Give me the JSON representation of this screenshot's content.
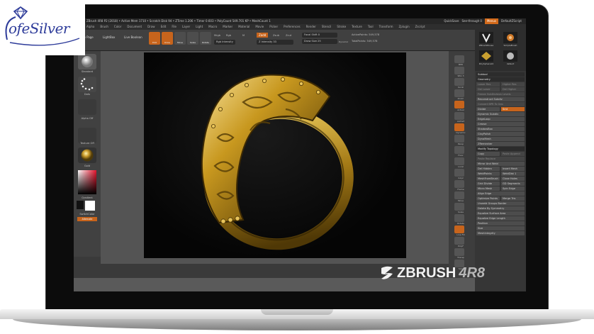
{
  "watermark": {
    "text": "ofeSilver"
  },
  "app": {
    "title_text": "ZBrush 4R8 P2 (2018) • Active Mem 1710 • Scratch Disk 94 • ZTime 1.206 • Timer 0.603 • PolyCount 549.701 KP • MeshCount 1",
    "quicksave": "QuickSave",
    "see_through": "See-through 0",
    "menus_label": "Menus",
    "default_script": "DefaultZScript"
  },
  "menubar": {
    "items": [
      "Alpha",
      "Brush",
      "Color",
      "Document",
      "Draw",
      "Edit",
      "File",
      "Layer",
      "Light",
      "Macro",
      "Marker",
      "Material",
      "Movie",
      "Picker",
      "Preferences",
      "Render",
      "Stencil",
      "Stroke",
      "Texture",
      "Tool",
      "Transform",
      "Zplugin",
      "Zscript"
    ]
  },
  "shelf": {
    "home_page": "Home Page",
    "lightbox": "LightBox",
    "live_boolean": "Live Boolean",
    "tools": [
      {
        "label": "Edit",
        "active": true
      },
      {
        "label": "Draw",
        "active": true
      },
      {
        "label": "Move",
        "active": false
      },
      {
        "label": "Scale",
        "active": false
      },
      {
        "label": "Rotate",
        "active": false
      }
    ],
    "mrgb": "Mrgb",
    "rgb": "Rgb",
    "m": "M",
    "zadd": "Zadd",
    "zsub": "Zsub",
    "zcut": "Zcut",
    "focal_shift": "Focal Shift 0",
    "draw_size": "Draw Size 25",
    "z_intensity": "Z Intensity 33",
    "rgb_intensity": "Rgb Intensity",
    "active_points": "ActivePoints: 549,578",
    "total_points": "TotalPoints: 549,578",
    "dynamic": "Dynamic"
  },
  "left_tray": {
    "standard": "Standard",
    "dots": "Dots",
    "alpha_off": "Alpha Off",
    "texture_off": "Texture Off",
    "gold": "Gold",
    "gradient": "Gradient",
    "switch_color": "SwitchColor",
    "alternate": "Alternate"
  },
  "right_shelf": {
    "items": [
      "BPR",
      "SPix 3",
      "Scroll",
      "Zoom",
      "Actual",
      "AAHalf",
      "Dynamic",
      "Persp",
      "Floor",
      "Local",
      "Gxyz",
      "Frame",
      "Move",
      "Scale",
      "Rotate",
      "Line Fill",
      "PolyF",
      "Transp",
      "Solo"
    ]
  },
  "panel": {
    "thumbs": [
      "ZBrushMouse",
      "SimpleBrush",
      "PolySphere10",
      "default"
    ],
    "rows": [
      {
        "text": "Subtool",
        "kind": "hdr"
      },
      {
        "text": "Geometry",
        "kind": "hdr"
      },
      {
        "text": "Lower Res",
        "kind": "dim",
        "half": true
      },
      {
        "text": "Higher Res",
        "kind": "dim",
        "half2": true
      },
      {
        "text": "Del Lower",
        "kind": "dim",
        "half": true
      },
      {
        "text": "Del Higher",
        "kind": "dim",
        "half2": true
      },
      {
        "text": "Freeze SubDivision Levels",
        "kind": "dim"
      },
      {
        "text": "Reconstruct Subdiv",
        "kind": "btn"
      },
      {
        "text": "Convert BPR To Geo",
        "kind": "dim"
      },
      {
        "text": "Divide",
        "kind": "btn",
        "half": true
      },
      {
        "text": "Smt",
        "kind": "orange",
        "half2": true
      },
      {
        "text": "Dynamic Subdiv",
        "kind": "btn"
      },
      {
        "text": "EdgeLoop",
        "kind": "btn"
      },
      {
        "text": "Crease",
        "kind": "btn"
      },
      {
        "text": "ShadowBox",
        "kind": "btn"
      },
      {
        "text": "ClayPolish",
        "kind": "btn"
      },
      {
        "text": "DynaMesh",
        "kind": "btn"
      },
      {
        "text": "ZRemesher",
        "kind": "btn"
      },
      {
        "text": "Modify Topology",
        "kind": "hdr"
      },
      {
        "text": "Copy",
        "kind": "btn",
        "half": true
      },
      {
        "text": "Paste Append",
        "kind": "dim",
        "half2": true
      },
      {
        "text": "Paste Replace",
        "kind": "dim"
      },
      {
        "text": "Mirror And Weld",
        "kind": "btn"
      },
      {
        "text": "Del Hidden",
        "kind": "btn",
        "half": true
      },
      {
        "text": "Insert Mesh",
        "kind": "btn",
        "half2": true
      },
      {
        "text": "WeldPoints",
        "kind": "btn",
        "half": true
      },
      {
        "text": "WeldDist 1",
        "kind": "btn",
        "half2": true
      },
      {
        "text": "MeshFromBrush",
        "kind": "btn",
        "half": true
      },
      {
        "text": "Close Holes",
        "kind": "btn",
        "half2": true
      },
      {
        "text": "Grid Divide",
        "kind": "btn",
        "half": true
      },
      {
        "text": "GD Segments",
        "kind": "btn",
        "half2": true
      },
      {
        "text": "Micro Mesh",
        "kind": "btn",
        "half": true
      },
      {
        "text": "Spin Edge",
        "kind": "btn",
        "half2": true
      },
      {
        "text": "Align Edge",
        "kind": "btn"
      },
      {
        "text": "Optimize Points",
        "kind": "btn",
        "half": true
      },
      {
        "text": "Merge Tris",
        "kind": "btn",
        "half2": true
      },
      {
        "text": "Unweld Groups Border",
        "kind": "btn"
      },
      {
        "text": "Delete By Symmetry",
        "kind": "btn"
      },
      {
        "text": "Equalize Surface Area",
        "kind": "btn"
      },
      {
        "text": "Equalize Edge Length",
        "kind": "btn"
      },
      {
        "text": "Position",
        "kind": "btn"
      },
      {
        "text": "Size",
        "kind": "btn"
      },
      {
        "text": "MeshIntegrity",
        "kind": "btn"
      }
    ]
  },
  "brand": {
    "name": "ZBRUSH",
    "version": "4R8"
  }
}
